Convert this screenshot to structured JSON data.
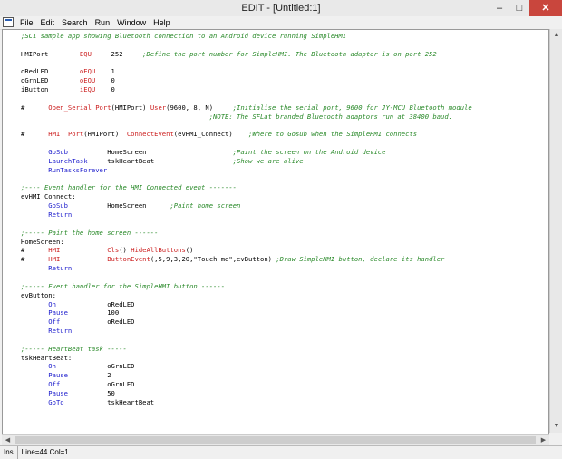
{
  "window": {
    "title": "EDIT - [Untitled:1]",
    "minimize": "–",
    "maximize": "□",
    "close": "✕"
  },
  "menu": [
    "File",
    "Edit",
    "Search",
    "Run",
    "Window",
    "Help"
  ],
  "status": {
    "mode": "Ins",
    "position": "Line=44 Col=1"
  },
  "code": [
    {
      "i": 0,
      "s": [
        {
          "c": "cmt",
          "t": ";SC1 sample app showing Bluetooth connection to an Android device running SimpleHMI"
        }
      ]
    },
    {
      "i": 2,
      "s": [
        {
          "c": "txt",
          "t": "HMIPort        "
        },
        {
          "c": "red",
          "t": "EQU"
        },
        {
          "c": "txt",
          "t": "     252     "
        },
        {
          "c": "cmt",
          "t": ";Define the port number for SimpleHMI. The Bluetooth adaptor is on port 252"
        }
      ]
    },
    {
      "i": 4,
      "s": [
        {
          "c": "txt",
          "t": "oRedLED        "
        },
        {
          "c": "red",
          "t": "oEQU"
        },
        {
          "c": "txt",
          "t": "    1"
        }
      ]
    },
    {
      "i": 5,
      "s": [
        {
          "c": "txt",
          "t": "oGrnLED        "
        },
        {
          "c": "red",
          "t": "oEQU"
        },
        {
          "c": "txt",
          "t": "    0"
        }
      ]
    },
    {
      "i": 6,
      "s": [
        {
          "c": "txt",
          "t": "iButton        "
        },
        {
          "c": "red",
          "t": "iEQU"
        },
        {
          "c": "txt",
          "t": "    0"
        }
      ]
    },
    {
      "i": 8,
      "s": [
        {
          "c": "txt",
          "t": "#      "
        },
        {
          "c": "red",
          "t": "Open_Serial Port"
        },
        {
          "c": "txt",
          "t": "(HMIPort) "
        },
        {
          "c": "red",
          "t": "User"
        },
        {
          "c": "txt",
          "t": "(9600, 8, N)     "
        },
        {
          "c": "cmt",
          "t": ";Initialise the serial port, 9600 for JY-MCU Bluetooth module"
        }
      ]
    },
    {
      "i": 9,
      "s": [
        {
          "c": "txt",
          "t": "                                                "
        },
        {
          "c": "cmt",
          "t": ";NOTE: The SFLat branded Bluetooth adaptors run at 38400 baud."
        }
      ]
    },
    {
      "i": 11,
      "s": [
        {
          "c": "txt",
          "t": "#      "
        },
        {
          "c": "red",
          "t": "HMI"
        },
        {
          "c": "txt",
          "t": "  "
        },
        {
          "c": "red",
          "t": "Port"
        },
        {
          "c": "txt",
          "t": "(HMIPort)  "
        },
        {
          "c": "red",
          "t": "ConnectEvent"
        },
        {
          "c": "txt",
          "t": "(evHMI_Connect)    "
        },
        {
          "c": "cmt",
          "t": ";Where to Gosub when the SimpleHMI connects"
        }
      ]
    },
    {
      "i": 13,
      "s": [
        {
          "c": "txt",
          "t": "       "
        },
        {
          "c": "kw",
          "t": "GoSub"
        },
        {
          "c": "txt",
          "t": "          HomeScreen                      "
        },
        {
          "c": "cmt",
          "t": ";Paint the screen on the Android device"
        }
      ]
    },
    {
      "i": 14,
      "s": [
        {
          "c": "txt",
          "t": "       "
        },
        {
          "c": "kw",
          "t": "LaunchTask"
        },
        {
          "c": "txt",
          "t": "     tskHeartBeat                    "
        },
        {
          "c": "cmt",
          "t": ";Show we are alive"
        }
      ]
    },
    {
      "i": 15,
      "s": [
        {
          "c": "txt",
          "t": "       "
        },
        {
          "c": "kw",
          "t": "RunTasksForever"
        }
      ]
    },
    {
      "i": 17,
      "s": [
        {
          "c": "cmt",
          "t": ";---- Event handler for the HMI Connected event -------"
        }
      ]
    },
    {
      "i": 18,
      "s": [
        {
          "c": "txt",
          "t": "evHMI_Connect:"
        }
      ]
    },
    {
      "i": 19,
      "s": [
        {
          "c": "txt",
          "t": "       "
        },
        {
          "c": "kw",
          "t": "GoSub"
        },
        {
          "c": "txt",
          "t": "          HomeScreen      "
        },
        {
          "c": "cmt",
          "t": ";Paint home screen"
        }
      ]
    },
    {
      "i": 20,
      "s": [
        {
          "c": "txt",
          "t": "       "
        },
        {
          "c": "kw",
          "t": "Return"
        }
      ]
    },
    {
      "i": 22,
      "s": [
        {
          "c": "cmt",
          "t": ";----- Paint the home screen ------"
        }
      ]
    },
    {
      "i": 23,
      "s": [
        {
          "c": "txt",
          "t": "HomeScreen:"
        }
      ]
    },
    {
      "i": 24,
      "s": [
        {
          "c": "txt",
          "t": "#      "
        },
        {
          "c": "red",
          "t": "HMI"
        },
        {
          "c": "txt",
          "t": "            "
        },
        {
          "c": "red",
          "t": "Cls"
        },
        {
          "c": "txt",
          "t": "() "
        },
        {
          "c": "red",
          "t": "HideAllButtons"
        },
        {
          "c": "txt",
          "t": "()"
        }
      ]
    },
    {
      "i": 25,
      "s": [
        {
          "c": "txt",
          "t": "#      "
        },
        {
          "c": "red",
          "t": "HMI"
        },
        {
          "c": "txt",
          "t": "            "
        },
        {
          "c": "red",
          "t": "ButtonEvent"
        },
        {
          "c": "txt",
          "t": "(,5,9,3,20,\"Touch me\",evButton) "
        },
        {
          "c": "cmt",
          "t": ";Draw SimpleHMI button, declare its handler"
        }
      ]
    },
    {
      "i": 26,
      "s": [
        {
          "c": "txt",
          "t": "       "
        },
        {
          "c": "kw",
          "t": "Return"
        }
      ]
    },
    {
      "i": 28,
      "s": [
        {
          "c": "cmt",
          "t": ";----- Event handler for the SimpleHMI button ------"
        }
      ]
    },
    {
      "i": 29,
      "s": [
        {
          "c": "txt",
          "t": "evButton:"
        }
      ]
    },
    {
      "i": 30,
      "s": [
        {
          "c": "txt",
          "t": "       "
        },
        {
          "c": "kw",
          "t": "On"
        },
        {
          "c": "txt",
          "t": "             oRedLED"
        }
      ]
    },
    {
      "i": 31,
      "s": [
        {
          "c": "txt",
          "t": "       "
        },
        {
          "c": "kw",
          "t": "Pause"
        },
        {
          "c": "txt",
          "t": "          100"
        }
      ]
    },
    {
      "i": 32,
      "s": [
        {
          "c": "txt",
          "t": "       "
        },
        {
          "c": "kw",
          "t": "Off"
        },
        {
          "c": "txt",
          "t": "            oRedLED"
        }
      ]
    },
    {
      "i": 33,
      "s": [
        {
          "c": "txt",
          "t": "       "
        },
        {
          "c": "kw",
          "t": "Return"
        }
      ]
    },
    {
      "i": 35,
      "s": [
        {
          "c": "cmt",
          "t": ";----- HeartBeat task -----"
        }
      ]
    },
    {
      "i": 36,
      "s": [
        {
          "c": "txt",
          "t": "tskHeartBeat:"
        }
      ]
    },
    {
      "i": 37,
      "s": [
        {
          "c": "txt",
          "t": "       "
        },
        {
          "c": "kw",
          "t": "On"
        },
        {
          "c": "txt",
          "t": "             oGrnLED"
        }
      ]
    },
    {
      "i": 38,
      "s": [
        {
          "c": "txt",
          "t": "       "
        },
        {
          "c": "kw",
          "t": "Pause"
        },
        {
          "c": "txt",
          "t": "          2"
        }
      ]
    },
    {
      "i": 39,
      "s": [
        {
          "c": "txt",
          "t": "       "
        },
        {
          "c": "kw",
          "t": "Off"
        },
        {
          "c": "txt",
          "t": "            oGrnLED"
        }
      ]
    },
    {
      "i": 40,
      "s": [
        {
          "c": "txt",
          "t": "       "
        },
        {
          "c": "kw",
          "t": "Pause"
        },
        {
          "c": "txt",
          "t": "          50"
        }
      ]
    },
    {
      "i": 41,
      "s": [
        {
          "c": "txt",
          "t": "       "
        },
        {
          "c": "kw",
          "t": "GoTo"
        },
        {
          "c": "txt",
          "t": "           tskHeartBeat"
        }
      ]
    }
  ]
}
